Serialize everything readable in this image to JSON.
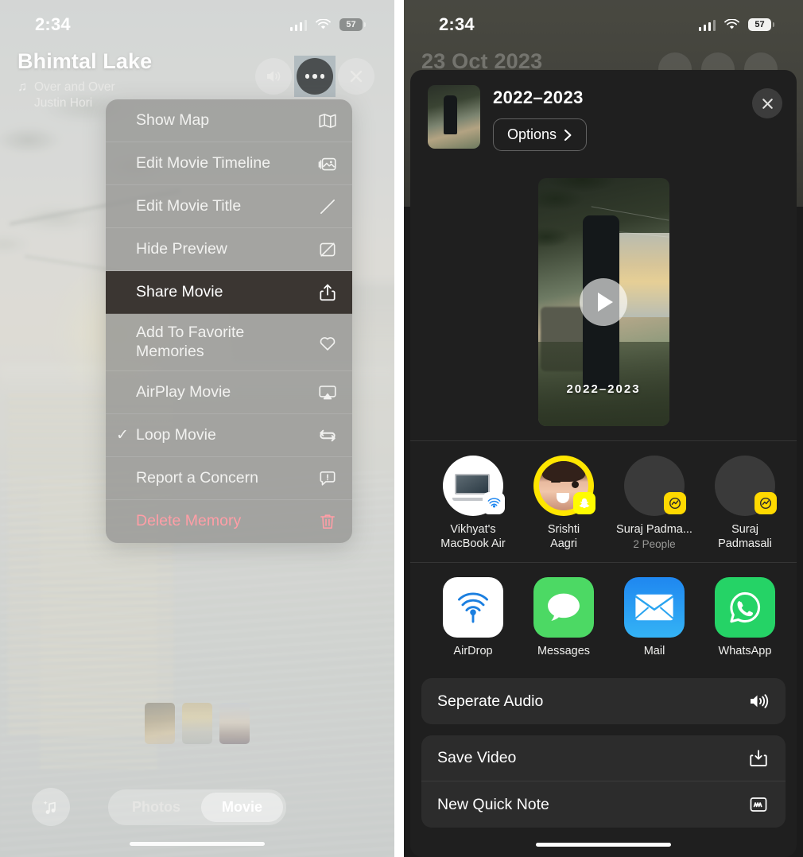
{
  "left_phone": {
    "status_bar": {
      "time": "2:34",
      "battery_percent": "57"
    },
    "memory_header": {
      "title": "Bhimtal Lake",
      "song_title": "Over and Over",
      "song_artist": "Justin Hori",
      "buttons": {
        "volume": "volume-icon",
        "more": "more-options-icon",
        "close": "close-icon"
      }
    },
    "context_menu": [
      {
        "label": "Show Map",
        "icon": "map-icon",
        "selected": false,
        "checked": false,
        "destructive": false
      },
      {
        "label": "Edit Movie Timeline",
        "icon": "photos-stack-icon",
        "selected": false,
        "checked": false,
        "destructive": false
      },
      {
        "label": "Edit Movie Title",
        "icon": "pencil-icon",
        "selected": false,
        "checked": false,
        "destructive": false
      },
      {
        "label": "Hide Preview",
        "icon": "hide-preview-icon",
        "selected": false,
        "checked": false,
        "destructive": false
      },
      {
        "label": "Share Movie",
        "icon": "share-icon",
        "selected": true,
        "checked": false,
        "destructive": false
      },
      {
        "label": "Add To Favorite\nMemories",
        "icon": "heart-icon",
        "selected": false,
        "checked": false,
        "destructive": false
      },
      {
        "label": "AirPlay Movie",
        "icon": "airplay-icon",
        "selected": false,
        "checked": false,
        "destructive": false
      },
      {
        "label": "Loop Movie",
        "icon": "loop-icon",
        "selected": false,
        "checked": true,
        "destructive": false
      },
      {
        "label": "Report a Concern",
        "icon": "report-icon",
        "selected": false,
        "checked": false,
        "destructive": false
      },
      {
        "label": "Delete Memory",
        "icon": "trash-icon",
        "selected": false,
        "checked": false,
        "destructive": true
      }
    ],
    "bottom": {
      "music_button": "music-sparkle-icon",
      "segmented": {
        "options": [
          "Photos",
          "Movie"
        ],
        "selected": "Movie"
      }
    }
  },
  "right_phone": {
    "status_bar": {
      "time": "2:34",
      "battery_percent": "57"
    },
    "background": {
      "date": "23 Oct 2023"
    },
    "share_sheet": {
      "title": "2022–2023",
      "options_label": "Options",
      "options_chevron": "chevron-right-icon",
      "close": "close-icon",
      "preview": {
        "caption": "2022–2023",
        "play": "play-icon"
      },
      "contacts": [
        {
          "name": "Vikhyat's\nMacBook Air",
          "sub": "",
          "badge": "airdrop-badge",
          "avatar": "macbook-icon"
        },
        {
          "name": "Srishti\nAagri",
          "sub": "",
          "badge": "snapchat-badge",
          "avatar": "memoji-avatar"
        },
        {
          "name": "Suraj Padma...",
          "sub": "2 People",
          "badge": "photos-badge",
          "avatar": "placeholder-avatar"
        },
        {
          "name": "Suraj\nPadmasali",
          "sub": "",
          "badge": "photos-badge",
          "avatar": "placeholder-avatar"
        }
      ],
      "apps": [
        {
          "name": "AirDrop",
          "icon": "airdrop-icon"
        },
        {
          "name": "Messages",
          "icon": "messages-icon"
        },
        {
          "name": "Mail",
          "icon": "mail-icon"
        },
        {
          "name": "WhatsApp",
          "icon": "whatsapp-icon"
        }
      ],
      "action_groups": [
        [
          {
            "label": "Seperate Audio",
            "icon": "speaker-icon"
          }
        ],
        [
          {
            "label": "Save Video",
            "icon": "save-download-icon"
          },
          {
            "label": "New Quick Note",
            "icon": "quick-note-icon"
          }
        ]
      ]
    }
  }
}
